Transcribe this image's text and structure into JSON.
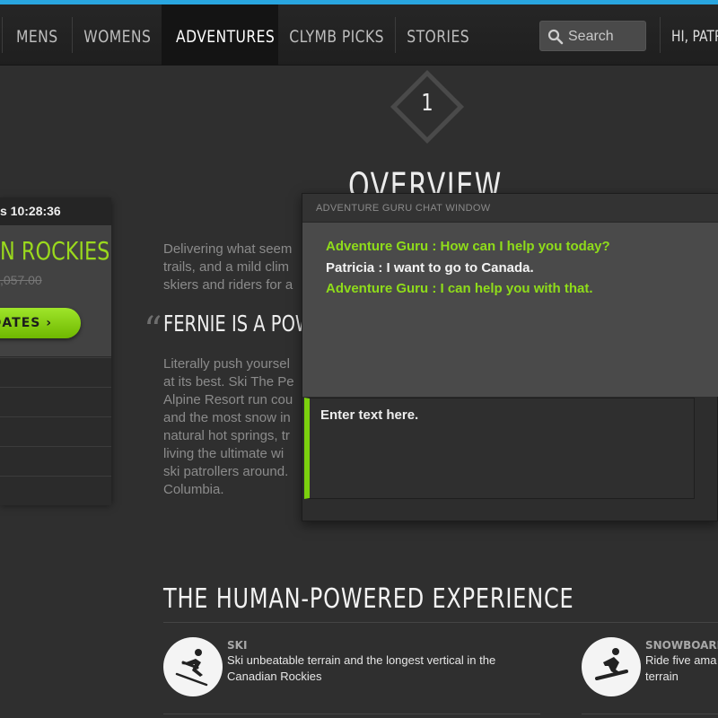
{
  "nav": {
    "items": [
      {
        "label": "MENS",
        "active": false
      },
      {
        "label": "WOMENS",
        "active": false
      },
      {
        "label": "ADVENTURES",
        "active": true
      },
      {
        "label": "CLYMB PICKS",
        "active": false
      },
      {
        "label": "STORIES",
        "active": false
      }
    ],
    "search_placeholder": "Search",
    "greeting": "HI, PATR"
  },
  "step": {
    "number": "1",
    "title": "OVERVIEW"
  },
  "deal": {
    "timer": "s 10:28:36",
    "title": "N ROCKIES",
    "old_price": ",057.00",
    "button_label": "DATES ›"
  },
  "content": {
    "para1": [
      "Delivering what seem",
      "trails, and a mild clim",
      "skiers and riders for a"
    ],
    "pull_quote": "FERNIE IS A POW",
    "para2": [
      "Literally push yoursel",
      "at its best. Ski The Pe",
      "Alpine Resort run cou",
      "and the most snow in",
      "natural hot springs, tr",
      "living the ultimate wi",
      "ski patrollers around.",
      "Columbia."
    ]
  },
  "chat": {
    "title": "ADVENTURE GURU CHAT WINDOW",
    "messages": [
      {
        "text": "Adventure Guru : How can I help you today?",
        "from": "guru"
      },
      {
        "text": "Patricia : I want to go to Canada.",
        "from": "user"
      },
      {
        "text": "Adventure Guru : I can help you with that.",
        "from": "guru"
      }
    ],
    "input_placeholder": "Enter text here."
  },
  "experience": {
    "title": "THE HUMAN-POWERED EXPERIENCE",
    "features": [
      {
        "label": "SKI",
        "desc": "Ski unbeatable terrain and the longest vertical in the Canadian Rockies",
        "icon": "skier-icon"
      },
      {
        "label": "SNOWBOARD",
        "desc": "Ride five ama terrain",
        "icon": "snowboarder-icon"
      }
    ]
  },
  "colors": {
    "accent": "#8fdc1a",
    "topline": "#29a6e0",
    "background": "#2f2f2f"
  }
}
